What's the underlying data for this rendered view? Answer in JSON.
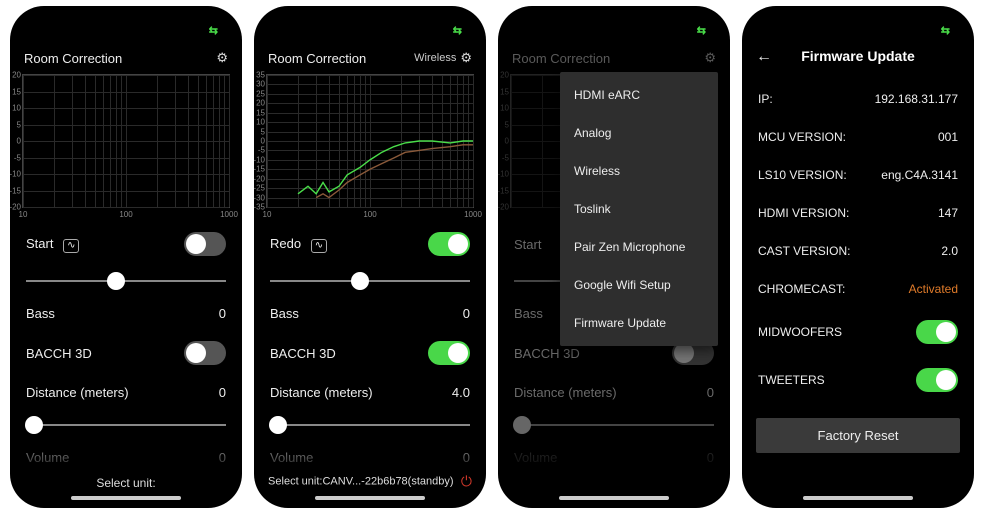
{
  "statusbar_icon": "⇆",
  "screen1": {
    "title": "Room Correction",
    "gear": "⚙",
    "action_label": "Start",
    "pulse_icon": "∿",
    "action_toggle_on": false,
    "slider_pos": 45,
    "bass_label": "Bass",
    "bass_value": "0",
    "bacch_label": "BACCH 3D",
    "bacch_on": false,
    "distance_label": "Distance (meters)",
    "distance_value": "0",
    "distance_slider_pos": 4,
    "volume_label": "Volume",
    "volume_value": "0",
    "select_unit": "Select unit:",
    "yticks": [
      "20",
      "15",
      "10",
      "5",
      "0",
      "-5",
      "-10",
      "-15",
      "-20"
    ],
    "xticks": [
      "10",
      "100",
      "1000"
    ]
  },
  "screen2": {
    "title": "Room Correction",
    "wireless_label": "Wireless",
    "gear": "⚙",
    "action_label": "Redo",
    "pulse_icon": "∿",
    "action_toggle_on": true,
    "slider_pos": 45,
    "bass_label": "Bass",
    "bass_value": "0",
    "bacch_label": "BACCH 3D",
    "bacch_on": true,
    "distance_label": "Distance (meters)",
    "distance_value": "4.0",
    "distance_slider_pos": 4,
    "volume_label": "Volume",
    "volume_value": "0",
    "select_unit": "Select unit:CANV...-22b6b78(standby)",
    "yticks": [
      "35",
      "30",
      "25",
      "20",
      "15",
      "10",
      "5",
      "0",
      "-5",
      "-10",
      "-15",
      "-20",
      "-25",
      "-30",
      "-35"
    ],
    "xticks": [
      "10",
      "100",
      "1000"
    ],
    "chart_data": {
      "type": "line",
      "xscale": "log",
      "xlim": [
        10,
        1000
      ],
      "ylim": [
        -35,
        35
      ],
      "series": [
        {
          "name": "green",
          "color": "#4ade4a",
          "x": [
            20,
            25,
            30,
            35,
            40,
            50,
            60,
            80,
            100,
            130,
            170,
            220,
            300,
            400,
            600,
            800,
            1000
          ],
          "y": [
            -28,
            -24,
            -28,
            -22,
            -27,
            -24,
            -18,
            -14,
            -10,
            -6,
            -3,
            -1,
            0,
            0,
            -1,
            0,
            0
          ]
        },
        {
          "name": "brown",
          "color": "#8b5a3a",
          "x": [
            30,
            35,
            40,
            50,
            60,
            80,
            100,
            130,
            170,
            220,
            300,
            400,
            600,
            800,
            1000
          ],
          "y": [
            -30,
            -28,
            -30,
            -26,
            -22,
            -18,
            -15,
            -12,
            -9,
            -6,
            -5,
            -4,
            -3,
            -2,
            -2
          ]
        }
      ]
    }
  },
  "screen3": {
    "title": "Room Correction",
    "gear": "⚙",
    "action_label": "Start",
    "slider_pos": 70,
    "bass_label": "Bass",
    "bass_value": "0",
    "bacch_label": "BACCH 3D",
    "distance_label": "Distance (meters)",
    "distance_value": "0",
    "distance_slider_pos": 4,
    "volume_label": "Volume",
    "volume_value": "0",
    "menu": [
      "HDMI eARC",
      "Analog",
      "Wireless",
      "Toslink",
      "Pair Zen Microphone",
      "Google Wifi Setup",
      "Firmware Update"
    ],
    "yticks": [
      "20",
      "15",
      "10",
      "5",
      "0",
      "-5",
      "-10",
      "-15",
      "-20"
    ]
  },
  "screen4": {
    "header": "Firmware Update",
    "rows": [
      {
        "label": "IP:",
        "value": "192.168.31.177"
      },
      {
        "label": "MCU VERSION:",
        "value": "001"
      },
      {
        "label": "LS10 VERSION:",
        "value": "eng.C4A.3141"
      },
      {
        "label": "HDMI VERSION:",
        "value": "147"
      },
      {
        "label": "CAST VERSION:",
        "value": "2.0"
      },
      {
        "label": "CHROMECAST:",
        "value": "Activated",
        "orange": true
      }
    ],
    "midwoofers_label": "MIDWOOFERS",
    "tweeters_label": "TWEETERS",
    "factory_reset": "Factory Reset"
  }
}
